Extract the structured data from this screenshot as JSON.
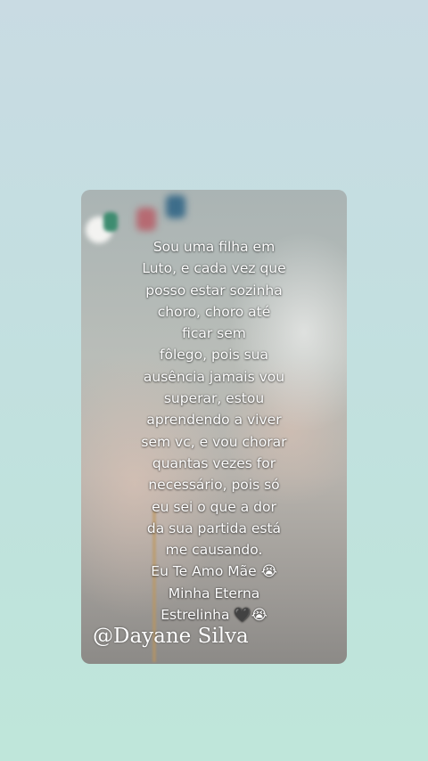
{
  "post": {
    "caption_lines": [
      "Sou uma filha em",
      "Luto, e cada vez que",
      "posso estar sozinha",
      "choro, choro até",
      "ficar sem",
      "fôlego, pois sua",
      "ausência jamais vou",
      "superar, estou",
      "aprendendo a viver",
      "sem vc, e vou chorar",
      "quantas vezes for",
      "necessário, pois só",
      "eu sei o que a dor",
      "da sua partida está",
      "me causando.",
      "Eu Te Amo Mãe 😭",
      "Minha Eterna",
      "Estrelinha 🖤😭"
    ],
    "author_handle": "@Dayane Silva"
  }
}
